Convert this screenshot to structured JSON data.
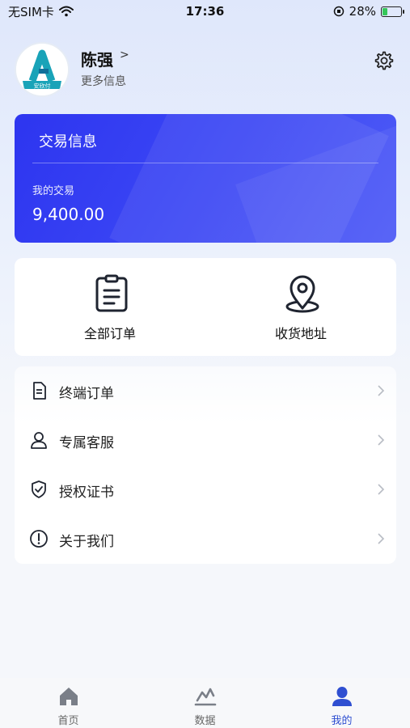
{
  "status_bar": {
    "carrier": "无SIM卡",
    "time": "17:36",
    "battery_percent": "28%",
    "battery_level": 0.28
  },
  "profile": {
    "name": "陈强",
    "arrow": ">",
    "more_info": "更多信息",
    "avatar_text": "安欣付"
  },
  "trade_card": {
    "title": "交易信息",
    "label": "我的交易",
    "value": "9,400.00"
  },
  "quick_actions": [
    {
      "label": "全部订单",
      "icon": "clipboard-icon"
    },
    {
      "label": "收货地址",
      "icon": "location-pin-icon"
    }
  ],
  "menu": [
    {
      "label": "终端订单",
      "icon": "document-icon"
    },
    {
      "label": "专属客服",
      "icon": "customer-service-icon"
    },
    {
      "label": "授权证书",
      "icon": "shield-check-icon"
    },
    {
      "label": "关于我们",
      "icon": "info-icon"
    }
  ],
  "tabbar": [
    {
      "label": "首页",
      "icon": "home-icon",
      "active": false
    },
    {
      "label": "数据",
      "icon": "chart-icon",
      "active": false
    },
    {
      "label": "我的",
      "icon": "user-icon",
      "active": true
    }
  ],
  "colors": {
    "accent": "#2f4fd1",
    "card_blue": "#3340f2"
  }
}
